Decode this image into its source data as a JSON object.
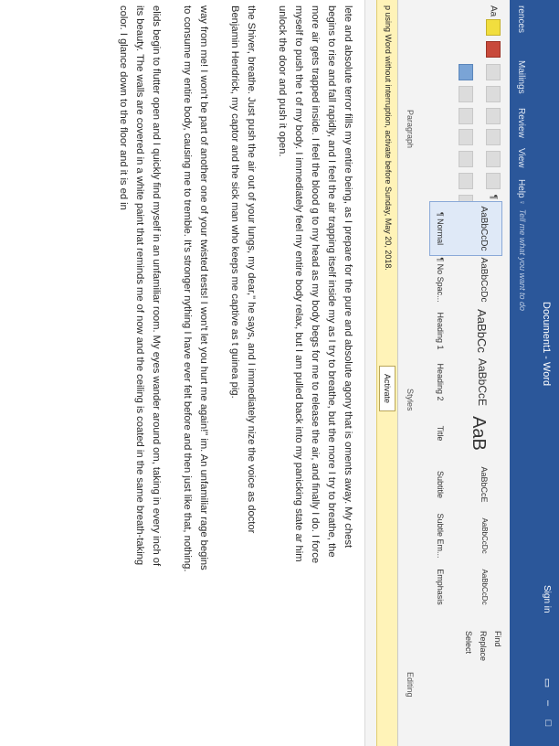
{
  "app": {
    "title": "Document1 - Word",
    "sign_in": "Sign in"
  },
  "tabs": [
    "rences",
    "Mailings",
    "Review",
    "View",
    "Help"
  ],
  "tell_me": "Tell me what you want to do",
  "ribbon": {
    "paragraph_label": "Paragraph",
    "styles_label": "Styles",
    "editing_label": "Editing",
    "font_btn": "Aa",
    "paragraph_mark": "¶",
    "styles": [
      {
        "sample": "AaBbCcDc",
        "name": "¶ Normal",
        "selected": true
      },
      {
        "sample": "AaBbCcDc",
        "name": "¶ No Spac...",
        "selected": false
      },
      {
        "sample": "AaBbCc",
        "name": "Heading 1",
        "selected": false
      },
      {
        "sample": "AaBbCcE",
        "name": "Heading 2",
        "selected": false
      },
      {
        "sample": "AaB",
        "name": "Title",
        "selected": false
      },
      {
        "sample": "AaBbCcE",
        "name": "Subtitle",
        "selected": false
      },
      {
        "sample": "AaBbCcDc",
        "name": "Subtle Em...",
        "selected": false
      },
      {
        "sample": "AaBbCcDc",
        "name": "Emphasis",
        "selected": false
      }
    ],
    "editing": [
      "Find",
      "Replace",
      "Select"
    ]
  },
  "infobar": {
    "message": "p using Word without interruption, activate before Sunday, May 20, 2018.",
    "button": "Activate"
  },
  "document": {
    "paragraphs": [
      "lete and absolute terror fills my entire being, as I prepare for the pure and absolute agony that is oments away. My chest begins to rise and fall rapidly, and I feel the air trapping itself inside my as I try to breathe, but the more I try to breathe, the more air gets trapped inside. I feel the blood g to my head as my body begs for me to release the air, and finally I do. I force myself to push the t of my body. I immediately feel my entire body relax, but I am pulled back into my panicking state ar him unlock the door and push it open.",
      "the Shiver, breathe. Just push the air out of your lungs, my dear,\" he says, and I immediately nize the voice as doctor Benjamin Hendrick, my captor and the sick man who keeps me captive as t guinea pig.",
      "way from me! I won't be part of another one of your twisted tests! I won't let you hurt me again!\" im. An unfamiliar rage begins to consume my entire body, causing me to tremble. It's stronger nything I have ever felt before and then just like that, nothing.",
      "elids begin to flutter open and I quickly find myself in an unfamiliar room. My eyes wander around om, taking in every inch of its beauty. The walls are covered in a white paint that reminds me of now and the ceiling is coated in the same breath-taking color. I glance down to the floor and it is ed in"
    ]
  },
  "colors": {
    "word_blue": "#2b579a",
    "infobar_yellow": "#fff3b8"
  }
}
